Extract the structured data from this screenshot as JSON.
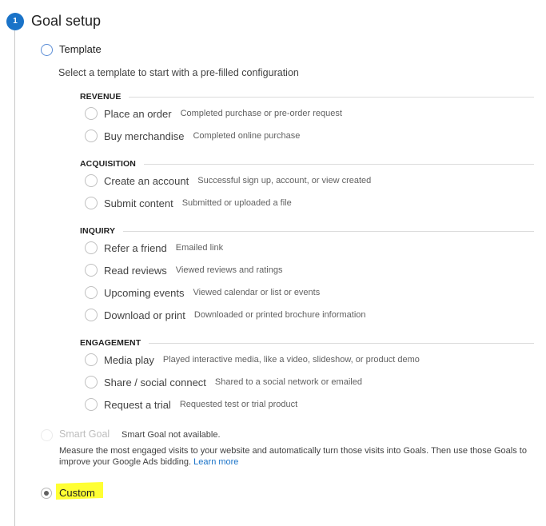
{
  "step": {
    "number": "1",
    "title": "Goal setup",
    "accent_color": "#1a73c8"
  },
  "template_option": {
    "label": "Template",
    "selected": false,
    "description": "Select a template to start with a pre-filled configuration"
  },
  "categories": [
    {
      "label": "REVENUE",
      "items": [
        {
          "name": "Place an order",
          "desc": "Completed purchase or pre-order request"
        },
        {
          "name": "Buy merchandise",
          "desc": "Completed online purchase"
        }
      ]
    },
    {
      "label": "ACQUISITION",
      "items": [
        {
          "name": "Create an account",
          "desc": "Successful sign up, account, or view created"
        },
        {
          "name": "Submit content",
          "desc": "Submitted or uploaded a file"
        }
      ]
    },
    {
      "label": "INQUIRY",
      "items": [
        {
          "name": "Refer a friend",
          "desc": "Emailed link"
        },
        {
          "name": "Read reviews",
          "desc": "Viewed reviews and ratings"
        },
        {
          "name": "Upcoming events",
          "desc": "Viewed calendar or list or events"
        },
        {
          "name": "Download or print",
          "desc": "Downloaded or printed brochure information"
        }
      ]
    },
    {
      "label": "ENGAGEMENT",
      "items": [
        {
          "name": "Media play",
          "desc": "Played interactive media, like a video, slideshow, or product demo"
        },
        {
          "name": "Share / social connect",
          "desc": "Shared to a social network or emailed"
        },
        {
          "name": "Request a trial",
          "desc": "Requested test or trial product"
        }
      ]
    }
  ],
  "smart_goal": {
    "label": "Smart Goal",
    "status": "Smart Goal not available.",
    "description": "Measure the most engaged visits to your website and automatically turn those visits into Goals. Then use those Goals to improve your Google Ads bidding.",
    "learn_more": "Learn more",
    "disabled": true
  },
  "custom_option": {
    "label": "Custom",
    "selected": true,
    "highlight_color": "#ffff33"
  }
}
